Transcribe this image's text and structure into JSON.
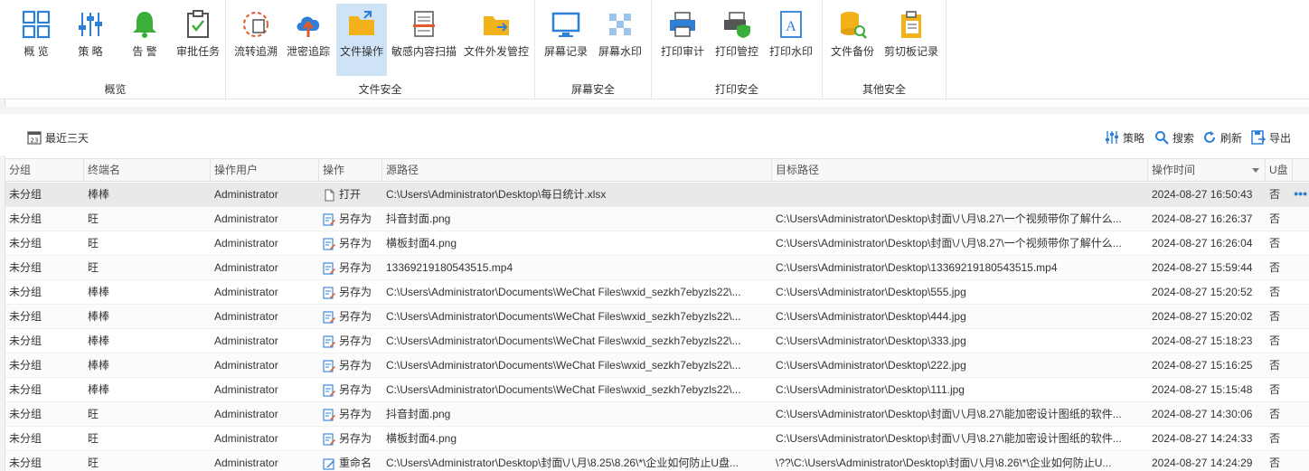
{
  "ribbon": {
    "groups": [
      {
        "label": "概览"
      },
      {
        "label": "文件安全"
      },
      {
        "label": "屏幕安全"
      },
      {
        "label": "打印安全"
      },
      {
        "label": "其他安全"
      }
    ],
    "buttons": {
      "overview": "概 览",
      "policy": "策 略",
      "alert": "告 警",
      "approval": "审批任务",
      "flow_trace": "流转追溯",
      "leak_trace": "泄密追踪",
      "file_ops": "文件操作",
      "sensitive_scan": "敏感内容扫描",
      "outbound_control": "文件外发管控",
      "screen_record": "屏幕记录",
      "screen_watermark": "屏幕水印",
      "print_audit": "打印审计",
      "print_control": "打印管控",
      "print_watermark": "打印水印",
      "file_backup": "文件备份",
      "clipboard_record": "剪切板记录"
    },
    "active_button": "file_ops",
    "accent": "#2d7fd8"
  },
  "toolbar": {
    "date_range": "最近三天",
    "calendar_day": "23",
    "policy": "策略",
    "search": "搜索",
    "refresh": "刷新",
    "export": "导出"
  },
  "table": {
    "headers": {
      "group": "分组",
      "terminal": "终端名",
      "user": "操作用户",
      "op": "操作",
      "src": "源路径",
      "dst": "目标路径",
      "time": "操作时间",
      "usb": "U盘"
    },
    "rows": [
      {
        "group": "未分组",
        "terminal": "棒棒",
        "user": "Administrator",
        "op": "打开",
        "icon": "file-open-icon",
        "src": "C:\\Users\\Administrator\\Desktop\\每日统计.xlsx",
        "dst": "",
        "time": "2024-08-27 16:50:43",
        "usb": "否",
        "more": "•••"
      },
      {
        "group": "未分组",
        "terminal": "旺",
        "user": "Administrator",
        "op": "另存为",
        "icon": "save-as-icon",
        "src": "抖音封面.png",
        "dst": "C:\\Users\\Administrator\\Desktop\\封面\\八月\\8.27\\一个视频带你了解什么...",
        "time": "2024-08-27 16:26:37",
        "usb": "否"
      },
      {
        "group": "未分组",
        "terminal": "旺",
        "user": "Administrator",
        "op": "另存为",
        "icon": "save-as-icon",
        "src": "横板封面4.png",
        "dst": "C:\\Users\\Administrator\\Desktop\\封面\\八月\\8.27\\一个视频带你了解什么...",
        "time": "2024-08-27 16:26:04",
        "usb": "否"
      },
      {
        "group": "未分组",
        "terminal": "旺",
        "user": "Administrator",
        "op": "另存为",
        "icon": "save-as-icon",
        "src": "13369219180543515.mp4",
        "dst": "C:\\Users\\Administrator\\Desktop\\13369219180543515.mp4",
        "time": "2024-08-27 15:59:44",
        "usb": "否"
      },
      {
        "group": "未分组",
        "terminal": "棒棒",
        "user": "Administrator",
        "op": "另存为",
        "icon": "save-as-icon",
        "src": "C:\\Users\\Administrator\\Documents\\WeChat Files\\wxid_sezkh7ebyzls22\\...",
        "dst": "C:\\Users\\Administrator\\Desktop\\555.jpg",
        "time": "2024-08-27 15:20:52",
        "usb": "否"
      },
      {
        "group": "未分组",
        "terminal": "棒棒",
        "user": "Administrator",
        "op": "另存为",
        "icon": "save-as-icon",
        "src": "C:\\Users\\Administrator\\Documents\\WeChat Files\\wxid_sezkh7ebyzls22\\...",
        "dst": "C:\\Users\\Administrator\\Desktop\\444.jpg",
        "time": "2024-08-27 15:20:02",
        "usb": "否"
      },
      {
        "group": "未分组",
        "terminal": "棒棒",
        "user": "Administrator",
        "op": "另存为",
        "icon": "save-as-icon",
        "src": "C:\\Users\\Administrator\\Documents\\WeChat Files\\wxid_sezkh7ebyzls22\\...",
        "dst": "C:\\Users\\Administrator\\Desktop\\333.jpg",
        "time": "2024-08-27 15:18:23",
        "usb": "否"
      },
      {
        "group": "未分组",
        "terminal": "棒棒",
        "user": "Administrator",
        "op": "另存为",
        "icon": "save-as-icon",
        "src": "C:\\Users\\Administrator\\Documents\\WeChat Files\\wxid_sezkh7ebyzls22\\...",
        "dst": "C:\\Users\\Administrator\\Desktop\\222.jpg",
        "time": "2024-08-27 15:16:25",
        "usb": "否"
      },
      {
        "group": "未分组",
        "terminal": "棒棒",
        "user": "Administrator",
        "op": "另存为",
        "icon": "save-as-icon",
        "src": "C:\\Users\\Administrator\\Documents\\WeChat Files\\wxid_sezkh7ebyzls22\\...",
        "dst": "C:\\Users\\Administrator\\Desktop\\111.jpg",
        "time": "2024-08-27 15:15:48",
        "usb": "否"
      },
      {
        "group": "未分组",
        "terminal": "旺",
        "user": "Administrator",
        "op": "另存为",
        "icon": "save-as-icon",
        "src": "抖音封面.png",
        "dst": "C:\\Users\\Administrator\\Desktop\\封面\\八月\\8.27\\能加密设计图纸的软件...",
        "time": "2024-08-27 14:30:06",
        "usb": "否"
      },
      {
        "group": "未分组",
        "terminal": "旺",
        "user": "Administrator",
        "op": "另存为",
        "icon": "save-as-icon",
        "src": "横板封面4.png",
        "dst": "C:\\Users\\Administrator\\Desktop\\封面\\八月\\8.27\\能加密设计图纸的软件...",
        "time": "2024-08-27 14:24:33",
        "usb": "否"
      },
      {
        "group": "未分组",
        "terminal": "旺",
        "user": "Administrator",
        "op": "重命名",
        "icon": "rename-icon",
        "src": "C:\\Users\\Administrator\\Desktop\\封面\\八月\\8.25\\8.26\\*\\企业如何防止U盘...",
        "dst": "\\??\\C:\\Users\\Administrator\\Desktop\\封面\\八月\\8.26\\*\\企业如何防止U...",
        "time": "2024-08-27 14:24:29",
        "usb": "否"
      }
    ]
  }
}
